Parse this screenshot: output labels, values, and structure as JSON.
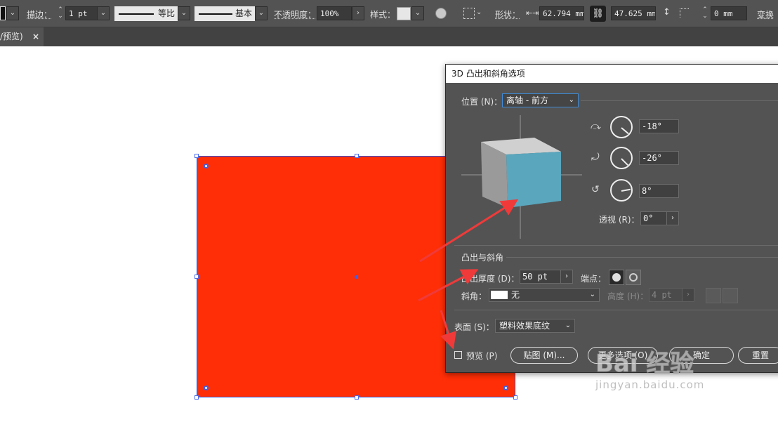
{
  "control_bar": {
    "stroke_label": "描边：",
    "stroke_value": "1 pt",
    "profile_label": "等比",
    "brush_label": "基本",
    "opacity_label": "不透明度：",
    "opacity_value": "100%",
    "style_label": "样式：",
    "shape_label": "形状：",
    "width_value": "62.794 mm",
    "height_value": "47.625 mm",
    "corner_value": "0 mm",
    "transform_label": "变换"
  },
  "tab": {
    "label": "/预览)",
    "close": "×"
  },
  "canvas": {
    "fill_color": "#ff2e06",
    "selection_color": "#3b63f0"
  },
  "dialog": {
    "title": "3D 凸出和斜角选项",
    "position_label": "位置 (N)：",
    "position_value": "离轴 - 前方",
    "rot_x": "-18°",
    "rot_y": "-26°",
    "rot_z": "8°",
    "perspective_label": "透视 (R)：",
    "perspective_value": "0°",
    "extrude_section": "凸出与斜角",
    "extrude_depth_label": "凸出厚度 (D)：",
    "extrude_depth_value": "50 pt",
    "cap_label": "端点：",
    "bevel_label": "斜角：",
    "bevel_value": "无",
    "height_label": "高度 (H)：",
    "height_value": "4 pt",
    "surface_label": "表面 (S)：",
    "surface_value": "塑料效果底纹",
    "preview_label": "预览 (P)",
    "map_button": "贴图 (M)...",
    "more_button": "更多选项 (O)",
    "ok_button": "确定",
    "reset_button": "重置",
    "cube_front_color": "#5aa6bd"
  },
  "watermark": {
    "brand": "Bai 经验",
    "url": "jingyan.baidu.com"
  }
}
